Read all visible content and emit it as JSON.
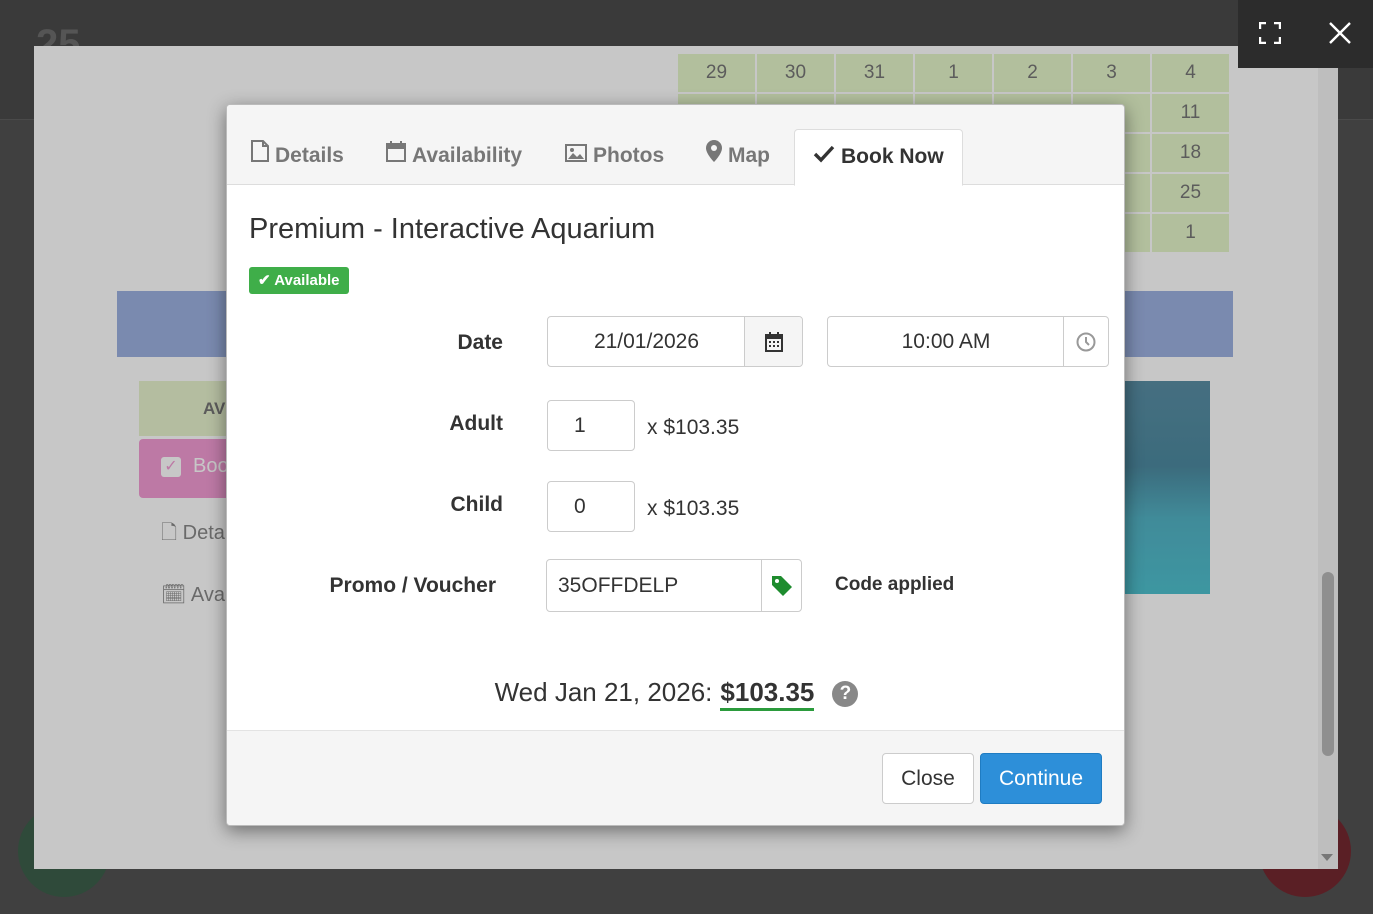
{
  "background_page": {
    "logo_text": "25",
    "calendar_rows": [
      [
        "29",
        "30",
        "31",
        "1",
        "2",
        "3",
        "4"
      ],
      [
        "",
        "",
        "",
        "",
        "",
        "",
        "11"
      ],
      [
        "",
        "",
        "",
        "",
        "",
        "",
        "18"
      ],
      [
        "",
        "",
        "",
        "",
        "",
        "",
        "25"
      ],
      [
        "",
        "",
        "",
        "",
        "",
        "",
        "1"
      ]
    ],
    "availability_tab": "AV",
    "book_tab": "Boo",
    "details_link": "Deta",
    "availability_link": "Avai"
  },
  "lightbox": {
    "expand_icon": "expand-icon",
    "close_icon": "close-icon"
  },
  "modal": {
    "tabs": [
      {
        "label": "Details",
        "icon": "file-icon"
      },
      {
        "label": "Availability",
        "icon": "calendar-icon"
      },
      {
        "label": "Photos",
        "icon": "image-icon"
      },
      {
        "label": "Map",
        "icon": "map-marker-icon"
      },
      {
        "label": "Book Now",
        "icon": "check-icon",
        "active": true
      }
    ],
    "title": "Premium - Interactive Aquarium",
    "status_badge": "Available",
    "form": {
      "date_label": "Date",
      "date_value": "21/01/2026",
      "time_value": "10:00 AM",
      "adult_label": "Adult",
      "adult_value": "1",
      "adult_price": "x $103.35",
      "child_label": "Child",
      "child_value": "0",
      "child_price": "x $103.35",
      "promo_label": "Promo / Voucher",
      "promo_value": "35OFFDELP",
      "promo_status": "Code applied"
    },
    "summary": {
      "date_text": "Wed Jan 21, 2026:",
      "total": "$103.35",
      "help_icon": "?"
    },
    "footer": {
      "close_label": "Close",
      "continue_label": "Continue"
    }
  },
  "colors": {
    "primary": "#2d8fd9",
    "success": "#3fae49",
    "promo_tag": "#1e8c2e",
    "book_tab": "#f29bd4"
  }
}
